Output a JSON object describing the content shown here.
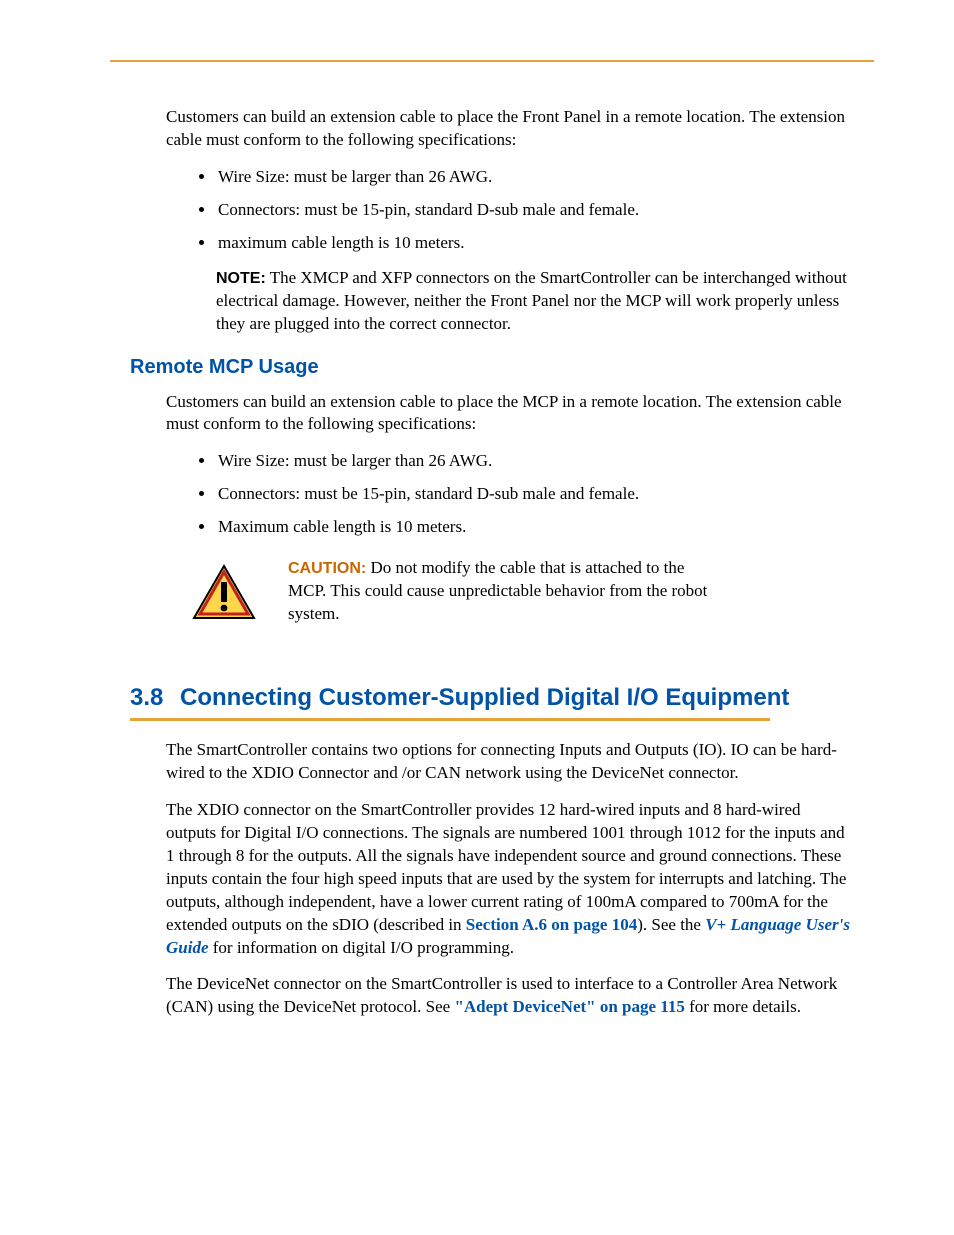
{
  "intro_para": "Customers can build an extension cable to place the Front Panel in a remote location. The extension cable must conform to the following specifications:",
  "intro_bullets": [
    "Wire Size: must be larger than 26 AWG.",
    "Connectors: must be 15-pin, standard D-sub male and female.",
    "maximum cable length is 10 meters."
  ],
  "note_label": "NOTE:",
  "note_text": " The XMCP and XFP connectors on the SmartController can be interchanged without electrical damage. However, neither the Front Panel nor the MCP will work properly unless they are plugged into the correct connector.",
  "subheading": "Remote MCP Usage",
  "mcp_para": "Customers can build an extension cable to place the MCP in a remote location. The extension cable must conform to the following specifications:",
  "mcp_bullets": [
    "Wire Size: must be larger than 26 AWG.",
    "Connectors: must be 15-pin, standard D-sub male and female.",
    "Maximum cable length is 10 meters."
  ],
  "caution_label": "CAUTION:",
  "caution_text": " Do not modify the cable that is attached to the MCP. This could cause unpredictable behavior from the robot system.",
  "section_num": "3.8",
  "section_title": "Connecting Customer-Supplied Digital I/O Equipment",
  "sec_para1": "The SmartController contains two options for connecting Inputs and Outputs (IO). IO can be hard-wired to the XDIO Connector and /or CAN network using the DeviceNet connector.",
  "sec_para2_a": "The XDIO connector on the SmartController provides 12 hard-wired inputs and 8 hard-wired outputs for Digital I/O connections. The signals are numbered 1001 through 1012 for the inputs and 1 through 8 for the outputs. All the signals have independent source and ground connections. These inputs contain the four high speed inputs that are used by the system for interrupts and latching. The outputs, although independent, have a lower current rating of 100mA compared to 700mA for the extended outputs on the sDIO (described in ",
  "link1": "Section A.6 on page 104",
  "sec_para2_b": "). See the ",
  "link2": "V+ Language User's Guide",
  "sec_para2_c": " for information on digital I/O programming.",
  "sec_para3_a": "The DeviceNet connector on the SmartController is used to interface to a Controller Area Network (CAN) using the DeviceNet protocol. See ",
  "link3": "\"Adept DeviceNet\" on page 115",
  "sec_para3_b": " for more details."
}
